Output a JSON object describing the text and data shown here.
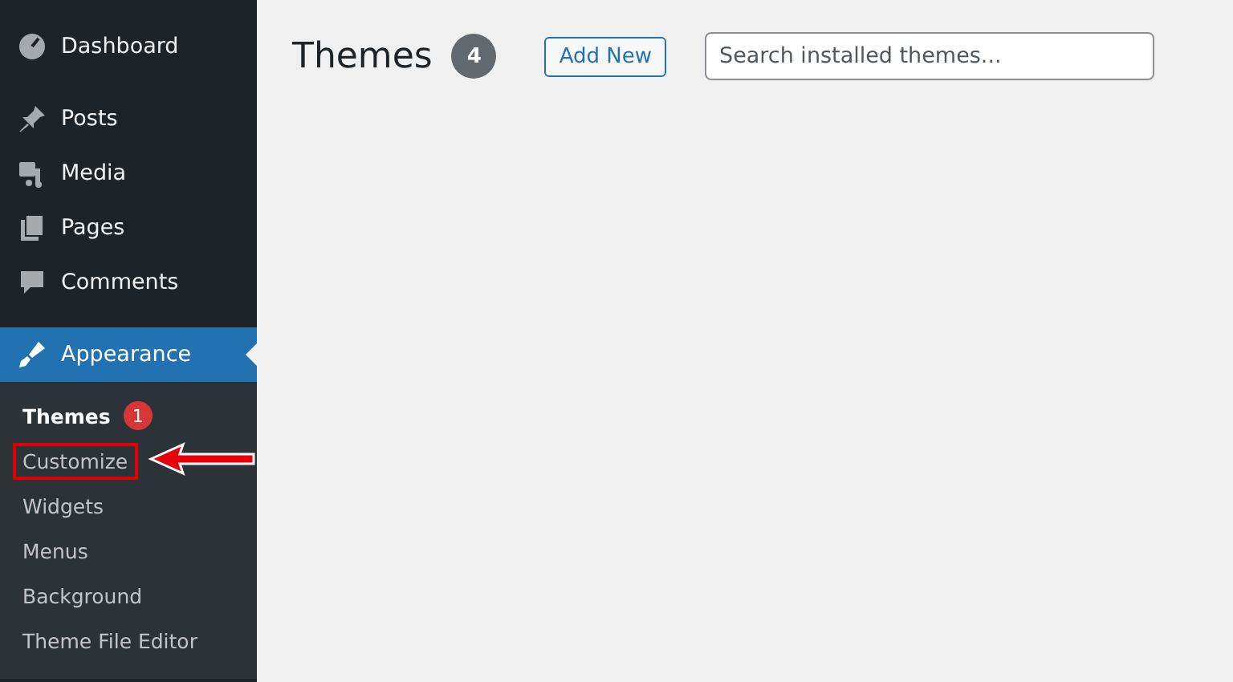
{
  "sidebar": {
    "items": [
      {
        "label": "Dashboard",
        "selected": false
      },
      {
        "label": "Posts",
        "selected": false
      },
      {
        "label": "Media",
        "selected": false
      },
      {
        "label": "Pages",
        "selected": false
      },
      {
        "label": "Comments",
        "selected": false
      },
      {
        "label": "Appearance",
        "selected": true,
        "submenu": [
          {
            "label": "Themes",
            "selected": true,
            "badge": "1",
            "highlighted": false
          },
          {
            "label": "Customize",
            "selected": false,
            "highlighted": true
          },
          {
            "label": "Widgets",
            "selected": false,
            "highlighted": false
          },
          {
            "label": "Menus",
            "selected": false,
            "highlighted": false
          },
          {
            "label": "Background",
            "selected": false,
            "highlighted": false
          },
          {
            "label": "Theme File Editor",
            "selected": false,
            "highlighted": false
          }
        ]
      }
    ]
  },
  "header": {
    "title": "Themes",
    "count": "4",
    "add_button": "Add New",
    "search": {
      "placeholder": "Search installed themes..."
    }
  }
}
